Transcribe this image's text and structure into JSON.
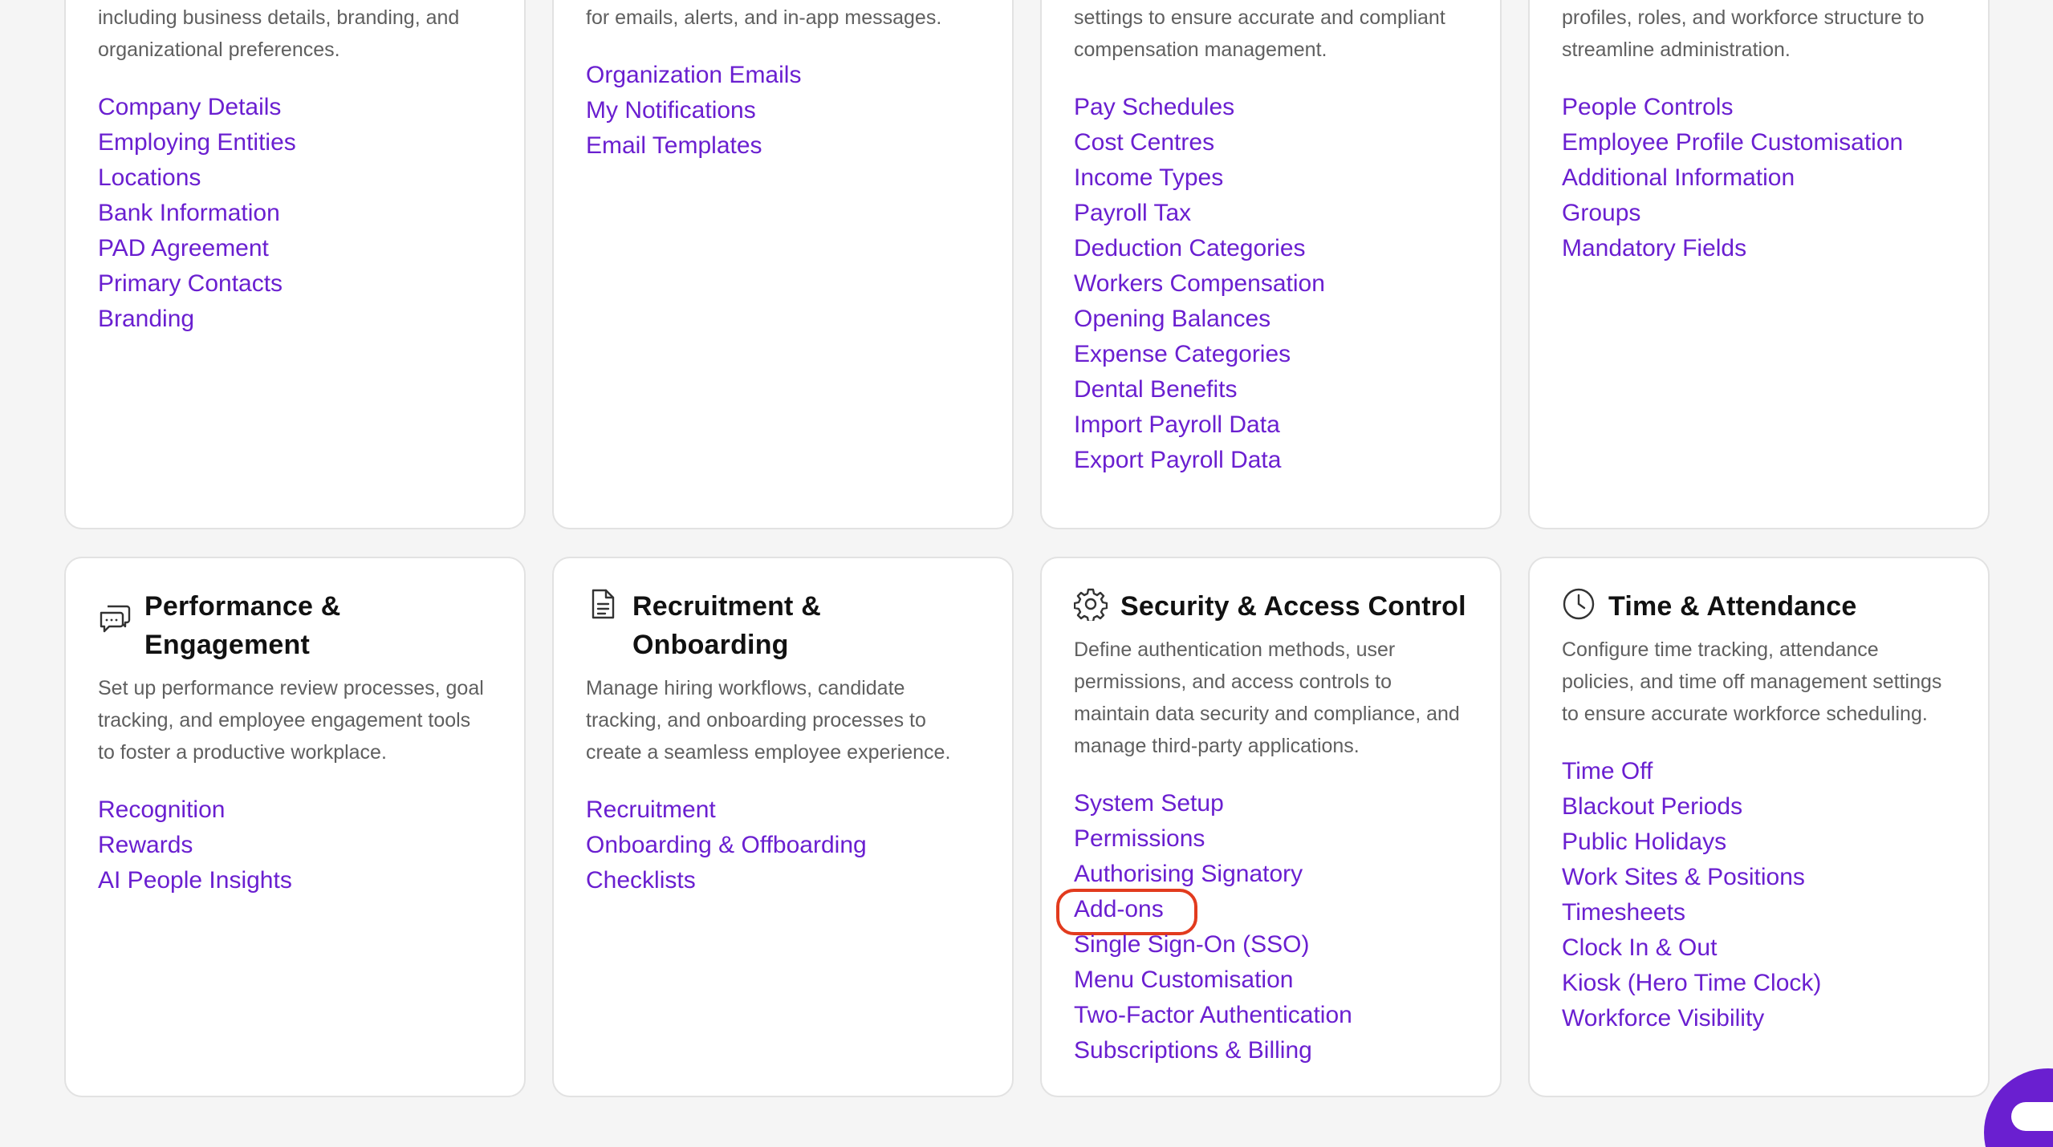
{
  "cards": [
    {
      "title": "",
      "description": "Define core company-wide settings, including business details, branding, and organizational preferences.",
      "links": [
        "Company Details",
        "Employing Entities",
        "Locations",
        "Bank Information",
        "PAD Agreement",
        "Primary Contacts",
        "Branding"
      ]
    },
    {
      "title": "",
      "description": "Set up and manage notification preferences for emails, alerts, and in-app messages.",
      "links": [
        "Organization Emails",
        "My Notifications",
        "Email Templates"
      ]
    },
    {
      "title": "",
      "description": "Configure payroll processing and tax settings to ensure accurate and compliant compensation management.",
      "links": [
        "Pay Schedules",
        "Cost Centres",
        "Income Types",
        "Payroll Tax",
        "Deduction Categories",
        "Workers Compensation",
        "Opening Balances",
        "Expense Categories",
        "Dental Benefits",
        "Import Payroll Data",
        "Export Payroll Data"
      ]
    },
    {
      "title": "",
      "description": "Control people-related settings, including profiles, roles, and workforce structure to streamline administration.",
      "links": [
        "People Controls",
        "Employee Profile Customisation",
        "Additional Information",
        "Groups",
        "Mandatory Fields"
      ]
    },
    {
      "icon": "chat-bubbles-icon",
      "title": "Performance & Engagement",
      "description": "Set up performance review processes, goal tracking, and employee engagement tools to foster a productive workplace.",
      "links": [
        "Recognition",
        "Rewards",
        "AI People Insights"
      ]
    },
    {
      "icon": "document-icon",
      "title": "Recruitment & Onboarding",
      "description": "Manage hiring workflows, candidate tracking, and onboarding processes to create a seamless employee experience.",
      "links": [
        "Recruitment",
        "Onboarding & Offboarding",
        "Checklists"
      ]
    },
    {
      "icon": "gear-icon",
      "title": "Security & Access Control",
      "description": "Define authentication methods, user permissions, and access controls to maintain data security and compliance, and manage third-party applications.",
      "links": [
        "System Setup",
        "Permissions",
        "Authorising Signatory",
        "Add-ons",
        "Single Sign-On (SSO)",
        "Menu Customisation",
        "Two-Factor Authentication",
        "Subscriptions & Billing"
      ]
    },
    {
      "icon": "clock-icon",
      "title": "Time & Attendance",
      "description": "Configure time tracking, attendance policies, and time off management settings to ensure accurate workforce scheduling.",
      "links": [
        "Time Off",
        "Blackout Periods",
        "Public Holidays",
        "Work Sites & Positions",
        "Timesheets",
        "Clock In & Out",
        "Kiosk (Hero Time Clock)",
        "Workforce Visibility"
      ]
    }
  ],
  "colors": {
    "link": "#6a1fd0",
    "highlight": "#e23b1e",
    "background": "#f5f5f5"
  }
}
